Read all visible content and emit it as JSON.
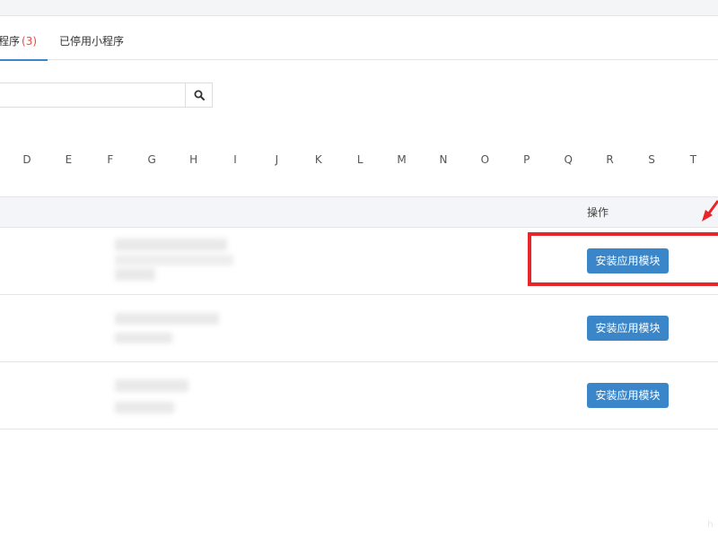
{
  "tabs": {
    "active": {
      "label": "程序",
      "count": "(3)"
    },
    "disabled_label": "已停用小程序"
  },
  "search": {
    "placeholder": "",
    "button_icon": "search-icon"
  },
  "letters": [
    "D",
    "E",
    "F",
    "G",
    "H",
    "I",
    "J",
    "K",
    "L",
    "M",
    "N",
    "O",
    "P",
    "Q",
    "R",
    "S",
    "T"
  ],
  "table": {
    "header_op": "操作",
    "rows": [
      {
        "button_label": "安装应用模块"
      },
      {
        "button_label": "安装应用模块"
      },
      {
        "button_label": "安装应用模块"
      }
    ]
  },
  "annotation": {
    "box_color": "#e8262a",
    "arrow_color": "#e8262a"
  },
  "colors": {
    "accent": "#3b86c8",
    "count": "#e64b3c",
    "header_bg": "#f4f5f8"
  }
}
